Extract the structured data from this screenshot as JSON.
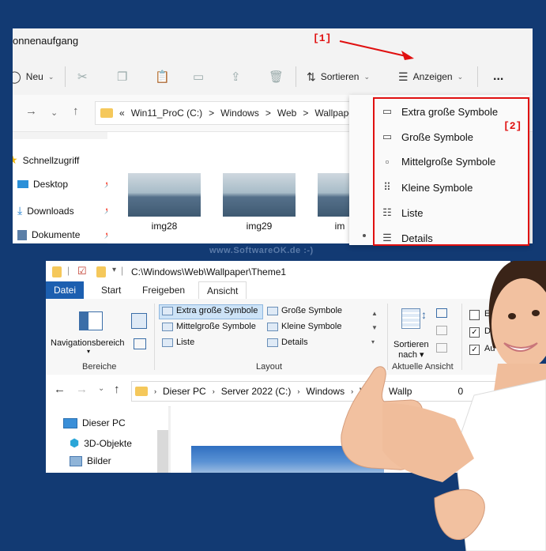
{
  "top_window": {
    "title_partial": "onnenaufgang",
    "toolbar": {
      "new_label": "Neu",
      "sort_label": "Sortieren",
      "view_label": "Anzeigen",
      "more_label": "..."
    },
    "address": {
      "chevron": "«",
      "path": [
        "Win11_ProC (C:)",
        "Windows",
        "Web",
        "Wallpaper"
      ],
      "separator": ">"
    },
    "sidebar": {
      "items": [
        {
          "label": "Schnellzugriff",
          "icon": "star-icon"
        },
        {
          "label": "Desktop",
          "icon": "desktop-icon"
        },
        {
          "label": "Downloads",
          "icon": "download-icon"
        },
        {
          "label": "Dokumente",
          "icon": "document-icon"
        }
      ]
    },
    "files": [
      {
        "name": "img28"
      },
      {
        "name": "img29"
      },
      {
        "name": "im"
      }
    ]
  },
  "view_menu": {
    "items": [
      {
        "label": "Extra große Symbole",
        "icon": "extra-large-icons-icon"
      },
      {
        "label": "Große Symbole",
        "icon": "large-icons-icon"
      },
      {
        "label": "Mittelgroße Symbole",
        "icon": "medium-icons-icon"
      },
      {
        "label": "Kleine Symbole",
        "icon": "small-icons-icon"
      },
      {
        "label": "Liste",
        "icon": "list-icon"
      },
      {
        "label": "Details",
        "icon": "details-icon"
      }
    ],
    "selected_item": "Details"
  },
  "annotations": {
    "label1": "[1]",
    "label2": "[2]",
    "watermark": "www.SoftwareOK.de :-)",
    "accent_color": "#e01010"
  },
  "bottom_window": {
    "title": "C:\\Windows\\Web\\Wallpaper\\Theme1",
    "tabs": [
      "Datei",
      "Start",
      "Freigeben",
      "Ansicht"
    ],
    "active_tab": "Ansicht",
    "ribbon": {
      "nav_pane_label": "Navigationsbereich",
      "group_panes": "Bereiche",
      "layout_options": [
        "Extra große Symbole",
        "Große Symbole",
        "Mittelgroße Symbole",
        "Kleine Symbole",
        "Liste",
        "Details"
      ],
      "selected_layout": "Extra große Symbole",
      "group_layout": "Layout",
      "sort_label": "Sortieren",
      "sort_sub": "nach",
      "group_current_view": "Aktuelle Ansicht",
      "checkboxes": [
        {
          "label": "Elem",
          "checked": false
        },
        {
          "label": "Dat",
          "checked": true
        },
        {
          "label": "Au",
          "checked": true
        }
      ]
    },
    "address": {
      "path": [
        "Dieser PC",
        "Server 2022 (C:)",
        "Windows",
        "We",
        "Wallp"
      ],
      "trailing": "0"
    },
    "sidebar": {
      "items": [
        {
          "label": "Dieser PC",
          "icon": "computer-icon"
        },
        {
          "label": "3D-Objekte",
          "icon": "cube-icon"
        },
        {
          "label": "Bilder",
          "icon": "pictures-icon"
        }
      ]
    }
  }
}
